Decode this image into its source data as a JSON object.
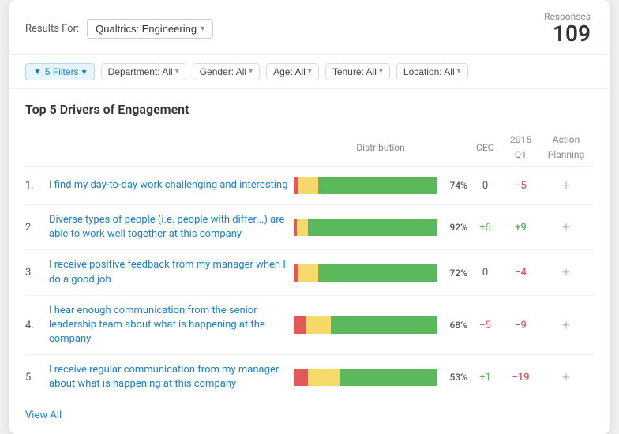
{
  "header": {
    "results_label": "Results For:",
    "dropdown_label": "Qualtrics: Engineering",
    "responses_label": "Responses",
    "responses_count": "109"
  },
  "filters": {
    "active_label": "5 Filters",
    "items": [
      {
        "label": "Department: All"
      },
      {
        "label": "Gender: All"
      },
      {
        "label": "Age: All"
      },
      {
        "label": "Tenure: All"
      },
      {
        "label": "Location: All"
      }
    ]
  },
  "section_title": "Top 5 Drivers of Engagement",
  "columns": {
    "distribution": "Distribution",
    "ceo": "CEO",
    "quarter": "2015\nQ1",
    "action_planning": "Action\nPlanning"
  },
  "drivers": [
    {
      "rank": "1.",
      "question": "I find my day-to-day work challenging and interesting",
      "bar": {
        "red": 3,
        "yellow": 14,
        "green": 83,
        "pct": "74%"
      },
      "ceo": "0",
      "delta": "−5",
      "delta_type": "neg"
    },
    {
      "rank": "2.",
      "question": "Diverse types of people (i.e. people with differ...) are able to work well together at this company",
      "bar": {
        "red": 2,
        "yellow": 8,
        "green": 90,
        "pct": "92%"
      },
      "ceo": "+6",
      "ceo_type": "pos",
      "delta": "+9",
      "delta_type": "pos"
    },
    {
      "rank": "3.",
      "question": "I receive positive feedback from my manager when I do a good job",
      "bar": {
        "red": 3,
        "yellow": 14,
        "green": 83,
        "pct": "72%"
      },
      "ceo": "0",
      "delta": "−4",
      "delta_type": "neg"
    },
    {
      "rank": "4.",
      "question": "I hear enough communication from the senior leadership team about what is happening at the company",
      "bar": {
        "red": 8,
        "yellow": 18,
        "green": 74,
        "pct": "68%"
      },
      "ceo": "−5",
      "ceo_type": "neg",
      "delta": "−9",
      "delta_type": "neg"
    },
    {
      "rank": "5.",
      "question": "I receive regular communication from my manager about what is happening at this company",
      "bar": {
        "red": 10,
        "yellow": 22,
        "green": 68,
        "pct": "53%"
      },
      "ceo": "+1",
      "ceo_type": "pos",
      "delta": "−19",
      "delta_type": "neg"
    }
  ],
  "view_all": "View All"
}
